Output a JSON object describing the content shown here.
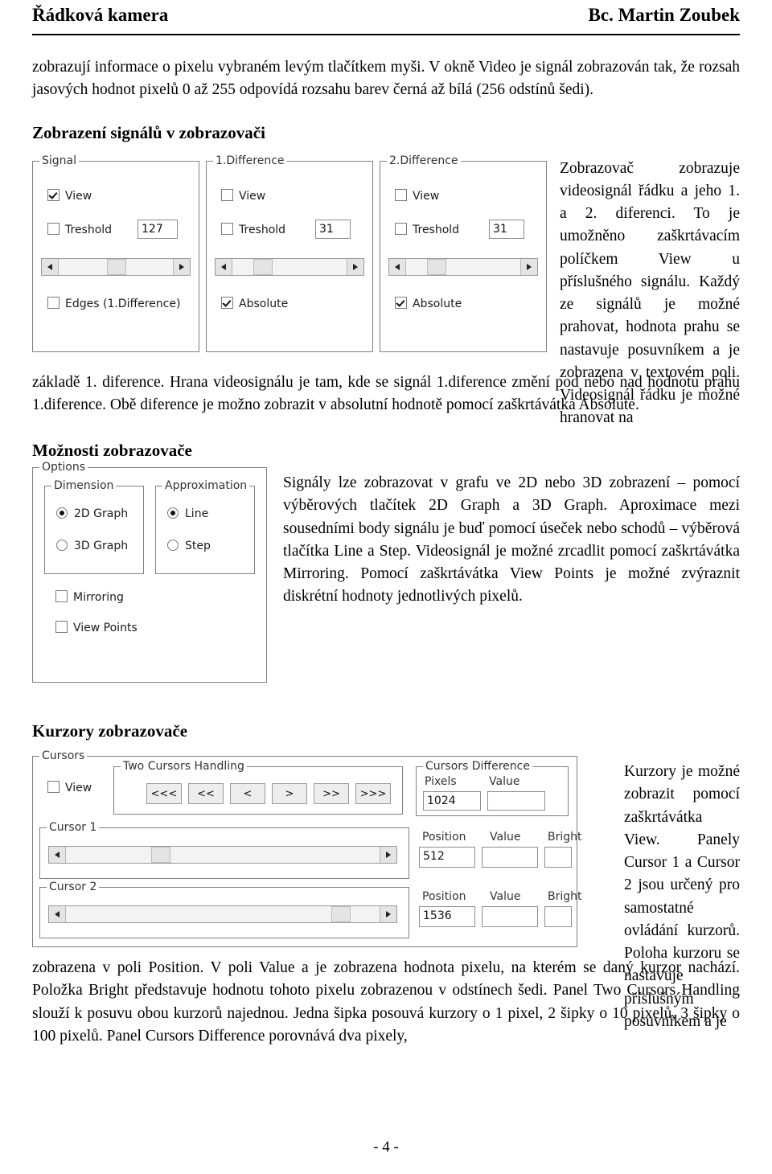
{
  "header": {
    "left": "Řádková kamera",
    "right": "Bc. Martin Zoubek"
  },
  "intro": {
    "paragraph": "zobrazují informace o pixelu vybraném levým tlačítkem myši. V okně Video je signál zobrazován tak, že rozsah jasových hodnot pixelů 0 až 255 odpovídá rozsahu barev černá až bílá (256 odstínů šedi)."
  },
  "section1": {
    "title": "Zobrazení signálů v zobrazovači",
    "side_text": "Zobrazovač zobrazuje videosignál řádku a jeho 1. a 2. diferenci. To je umožněno zaškrtávacím políčkem View u příslušného signálu. Každý ze signálů je možné prahovat, hodnota prahu se nastavuje posuvníkem a je zobrazena v textovém poli. Videosignál řádku je možné hranovat na",
    "below_text": "základě 1. diference. Hrana videosignálu je tam, kde se signál 1.diference změní pod nebo nad hodnotu prahu 1.diference. Obě diference je možno zobrazit v absolutní hodnotě pomocí zaškrtávátka Absolute."
  },
  "signal_panel": {
    "groups": [
      {
        "legend": "Signal",
        "view_label": "View",
        "view_checked": true,
        "treshold_label": "Treshold",
        "treshold_checked": false,
        "treshold_value": "127",
        "extra_label": "Edges (1.Difference)",
        "extra_checked": false,
        "extra_type": "checkbox"
      },
      {
        "legend": "1.Difference",
        "view_label": "View",
        "view_checked": false,
        "treshold_label": "Treshold",
        "treshold_checked": false,
        "treshold_value": "31",
        "extra_label": "Absolute",
        "extra_checked": true,
        "extra_type": "checkbox"
      },
      {
        "legend": "2.Difference",
        "view_label": "View",
        "view_checked": false,
        "treshold_label": "Treshold",
        "treshold_checked": false,
        "treshold_value": "31",
        "extra_label": "Absolute",
        "extra_checked": true,
        "extra_type": "checkbox"
      }
    ]
  },
  "section2": {
    "title": "Možnosti zobrazovače",
    "text": "Signály lze zobrazovat v grafu ve 2D nebo 3D zobrazení – pomocí výběrových tlačítek 2D Graph a 3D Graph. Aproximace mezi sousedními body signálu je buď pomocí úseček nebo schodů – výběrová tlačítka Line a Step. Videosignál je možné zrcadlit pomocí zaškrtávátka Mirroring. Pomocí zaškrtávátka View Points je možné zvýraznit diskrétní hodnoty jednotlivých pixelů."
  },
  "options_panel": {
    "legend": "Options",
    "dimension": {
      "legend": "Dimension",
      "options": [
        {
          "label": "2D Graph",
          "checked": true
        },
        {
          "label": "3D Graph",
          "checked": false
        }
      ]
    },
    "approximation": {
      "legend": "Approximation",
      "options": [
        {
          "label": "Line",
          "checked": true
        },
        {
          "label": "Step",
          "checked": false
        }
      ]
    },
    "checkboxes": [
      {
        "label": "Mirroring",
        "checked": false
      },
      {
        "label": "View Points",
        "checked": false
      }
    ]
  },
  "section3": {
    "title": "Kurzory zobrazovače",
    "side_text": "Kurzory je možné zobrazit pomocí zaškrtávátka View. Panely Cursor 1 a Cursor 2 jsou určený pro samostatné ovládání kurzorů. Poloha kurzoru se nastavuje příslušným posuvníkem a je",
    "below_text": "zobrazena v poli Position. V poli Value a je zobrazena hodnota pixelu, na kterém se daný kurzor nachází. Položka Bright představuje hodnotu tohoto pixelu zobrazenou v odstínech šedi. Panel Two Cursors Handling slouží k posuvu obou kurzorů najednou. Jedna šipka posouvá kurzory o 1 pixel, 2 šipky o 10 pixelů, 3 šipky o 100 pixelů. Panel Cursors Difference porovnává dva pixely,"
  },
  "cursors_panel": {
    "legend": "Cursors",
    "view_label": "View",
    "view_checked": false,
    "two_cursors": {
      "legend": "Two Cursors Handling",
      "buttons": [
        "<<<",
        "<<",
        "<",
        ">",
        ">>",
        ">>>"
      ]
    },
    "cursors_difference": {
      "legend": "Cursors Difference",
      "pixels_label": "Pixels",
      "pixels_value": "1024",
      "value_label": "Value",
      "value_value": ""
    },
    "cursor1": {
      "legend": "Cursor 1",
      "position_label": "Position",
      "position_value": "512",
      "value_label": "Value",
      "value_value": "",
      "bright_label": "Bright"
    },
    "cursor2": {
      "legend": "Cursor 2",
      "position_label": "Position",
      "position_value": "1536",
      "value_label": "Value",
      "value_value": "",
      "bright_label": "Bright"
    }
  },
  "footer": {
    "page": "- 4 -"
  }
}
